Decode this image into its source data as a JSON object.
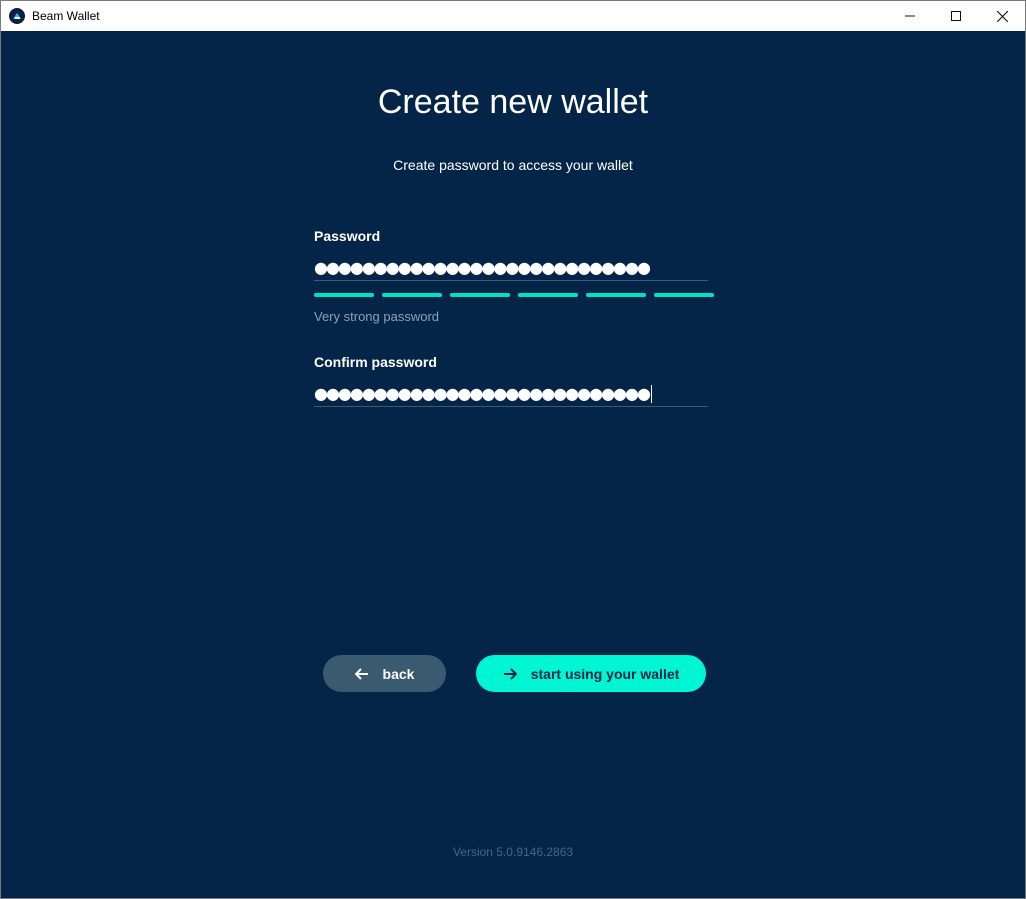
{
  "window": {
    "title": "Beam Wallet",
    "controls": [
      "minimize-icon",
      "maximize-icon",
      "close-icon"
    ]
  },
  "page": {
    "title": "Create new wallet",
    "subtitle": "Create password to access your wallet"
  },
  "password": {
    "label": "Password",
    "value": "●●●●●●●●●●●●●●●●●●●●●●●●●●●●",
    "strength_segments": 6,
    "strength_filled": 6,
    "strength_label": "Very strong password"
  },
  "confirm": {
    "label": "Confirm password",
    "value": "●●●●●●●●●●●●●●●●●●●●●●●●●●●●"
  },
  "buttons": {
    "back": "back",
    "start": "start using your wallet"
  },
  "footer": {
    "version": "Version 5.0.9146.2863"
  },
  "colors": {
    "background": "#042548",
    "accent": "#00f6d2",
    "strength": "#00e2c2",
    "back_button": "#3a5a70"
  }
}
